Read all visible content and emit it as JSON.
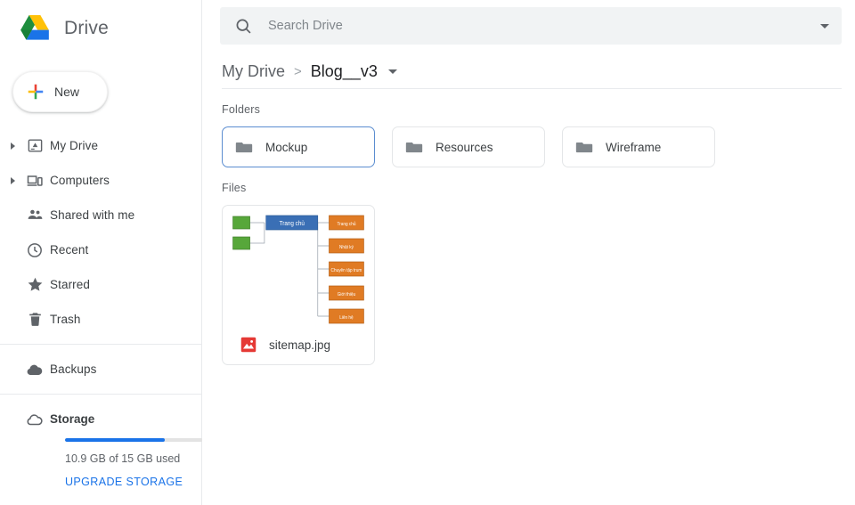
{
  "app": {
    "brand_name": "Drive",
    "logo_icon": "drive-triangle-logo"
  },
  "new_button": {
    "label": "New",
    "icon": "plus-icon"
  },
  "search": {
    "placeholder": "Search Drive",
    "value": "",
    "icon": "search-icon",
    "dropdown_icon": "chevron-down-icon"
  },
  "sidebar": {
    "items": [
      {
        "label": "My Drive",
        "icon": "my-drive-icon",
        "expandable": true
      },
      {
        "label": "Computers",
        "icon": "computers-icon",
        "expandable": true
      },
      {
        "label": "Shared with me",
        "icon": "people-icon",
        "expandable": false
      },
      {
        "label": "Recent",
        "icon": "clock-icon",
        "expandable": false
      },
      {
        "label": "Starred",
        "icon": "star-icon",
        "expandable": false
      },
      {
        "label": "Trash",
        "icon": "trash-icon",
        "expandable": false
      },
      {
        "label": "Backups",
        "icon": "cloud-filled-icon",
        "expandable": false
      }
    ],
    "storage": {
      "label": "Storage",
      "icon": "cloud-outline-icon",
      "used_text": "10.9 GB of 15 GB used",
      "upgrade_label": "UPGRADE STORAGE",
      "percent_used": 72,
      "bar_color": "#1a73e8"
    }
  },
  "breadcrumb": {
    "root": "My Drive",
    "separator": ">",
    "current": "Blog__v3",
    "dropdown_icon": "chevron-down-icon"
  },
  "main": {
    "folders_title": "Folders",
    "files_title": "Files",
    "folders": [
      {
        "name": "Mockup",
        "icon": "folder-icon",
        "selected": true
      },
      {
        "name": "Resources",
        "icon": "folder-icon",
        "selected": false
      },
      {
        "name": "Wireframe",
        "icon": "folder-icon",
        "selected": false
      }
    ],
    "files": [
      {
        "name": "sitemap.jpg",
        "type_icon": "image-file-icon",
        "thumbnail": {
          "kind": "sitemap-diagram",
          "root_node": "Trang chủ",
          "root_color": "#3a6fb5",
          "left_nodes": [
            "",
            ""
          ],
          "left_color": "#57a73a",
          "branch_color": "#e07b24",
          "branches": [
            "Trang chủ",
            "Nhật ký",
            "Chuyên tập trum",
            "Giới thiệu",
            "Liên hệ"
          ]
        }
      }
    ]
  },
  "colors": {
    "accent_blue": "#1a73e8",
    "selected_border": "#5b8dd0",
    "search_bg": "#f1f3f4",
    "text_primary": "#3c4043",
    "text_secondary": "#5f6368"
  }
}
